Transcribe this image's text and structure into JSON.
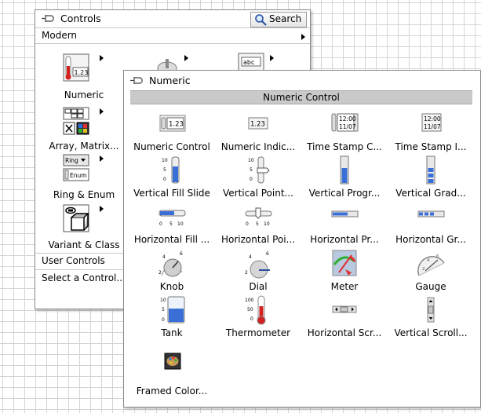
{
  "controls_palette": {
    "title": "Controls",
    "search_label": "Search",
    "modern_label": "Modern",
    "categories": [
      {
        "label": "Numeric",
        "icon": "numeric-icon"
      },
      {
        "label": "Array, Matrix...",
        "icon": "array-matrix-icon"
      },
      {
        "label": "Ring & Enum",
        "icon": "ring-enum-icon"
      },
      {
        "label": "Variant & Class",
        "icon": "variant-class-icon"
      }
    ],
    "user_controls_label": "User Controls",
    "select_control_label": "Select a Control..."
  },
  "numeric_palette": {
    "title": "Numeric",
    "header": "Numeric Control",
    "items": [
      {
        "label": "Numeric Control",
        "icon": "numeric-control-icon"
      },
      {
        "label": "Numeric Indic...",
        "icon": "numeric-indicator-icon"
      },
      {
        "label": "Time Stamp C...",
        "icon": "time-stamp-control-icon"
      },
      {
        "label": "Time Stamp I...",
        "icon": "time-stamp-indicator-icon"
      },
      {
        "label": "Vertical Fill Slide",
        "icon": "vertical-fill-slide-icon"
      },
      {
        "label": "Vertical Point...",
        "icon": "vertical-pointer-slide-icon"
      },
      {
        "label": "Vertical Progr...",
        "icon": "vertical-progress-bar-icon"
      },
      {
        "label": "Vertical Grad...",
        "icon": "vertical-graduated-bar-icon"
      },
      {
        "label": "Horizontal Fill ...",
        "icon": "horizontal-fill-slide-icon"
      },
      {
        "label": "Horizontal Poi...",
        "icon": "horizontal-pointer-slide-icon"
      },
      {
        "label": "Horizontal Pr...",
        "icon": "horizontal-progress-bar-icon"
      },
      {
        "label": "Horizontal Gr...",
        "icon": "horizontal-graduated-bar-icon"
      },
      {
        "label": "Knob",
        "icon": "knob-icon"
      },
      {
        "label": "Dial",
        "icon": "dial-icon"
      },
      {
        "label": "Meter",
        "icon": "meter-icon"
      },
      {
        "label": "Gauge",
        "icon": "gauge-icon"
      },
      {
        "label": "Tank",
        "icon": "tank-icon"
      },
      {
        "label": "Thermometer",
        "icon": "thermometer-icon"
      },
      {
        "label": "Horizontal Scr...",
        "icon": "horizontal-scrollbar-icon"
      },
      {
        "label": "Vertical Scroll...",
        "icon": "vertical-scrollbar-icon"
      },
      {
        "label": "Framed Color...",
        "icon": "framed-color-box-icon"
      }
    ],
    "icon_texts": {
      "value": "1.23",
      "time": "12:00",
      "date": "11/07",
      "abc": "abc",
      "ring": "Ring",
      "enum": "Enum",
      "tick_10": "10",
      "tick_5": "5",
      "tick_0": "0",
      "tick_100": "100",
      "tick_50": "50"
    }
  },
  "colors": {
    "header_bg": "#c9c9c9",
    "fill_blue": "#3a6fd8",
    "thermo_red": "#d42020"
  }
}
